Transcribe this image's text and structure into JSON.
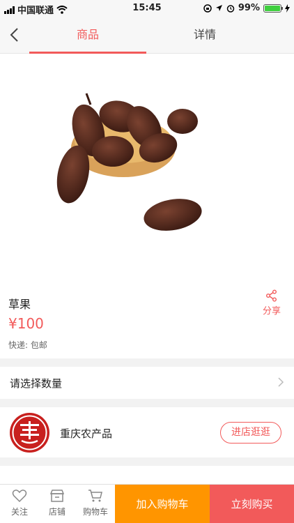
{
  "status_bar": {
    "carrier": "中国联通",
    "time": "15:45",
    "battery": "99%",
    "battery_level": 0.99
  },
  "nav": {
    "tabs": [
      {
        "label": "商品",
        "active": true
      },
      {
        "label": "详情",
        "active": false
      }
    ]
  },
  "product": {
    "name": "草果",
    "price": "¥100",
    "shipping": "快递: 包邮",
    "share_label": "分享"
  },
  "quantity": {
    "label": "请选择数量"
  },
  "shop": {
    "name": "重庆农产品",
    "enter_label": "进店逛逛"
  },
  "bottom_bar": {
    "follow_label": "关注",
    "shop_label": "店铺",
    "cart_label": "购物车",
    "add_to_cart_label": "加入购物车",
    "buy_now_label": "立刻购买"
  },
  "colors": {
    "accent": "#f25a5a",
    "orange": "#ff9500",
    "shop_logo": "#c8201e"
  }
}
